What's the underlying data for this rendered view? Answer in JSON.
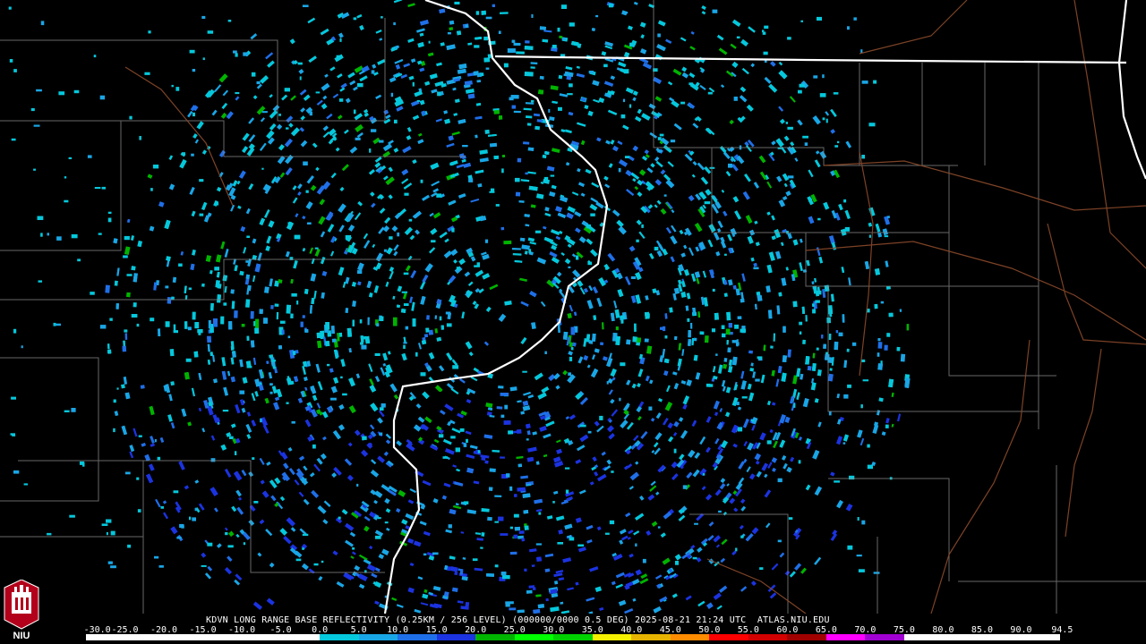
{
  "product": {
    "title": "KDVN LONG RANGE BASE REFLECTIVITY (0.25KM / 256 LEVEL) (000000/0000 0.5 DEG) 2025-08-21 21:24 UTC  ATLAS.NIU.EDU"
  },
  "scale": {
    "labels": [
      "-30.0",
      "-25.0",
      "-20.0",
      "-15.0",
      "-10.0",
      "-5.0",
      "0.0",
      "5.0",
      "10.0",
      "15.0",
      "20.0",
      "25.0",
      "30.0",
      "35.0",
      "40.0",
      "45.0",
      "50.0",
      "55.0",
      "60.0",
      "65.0",
      "70.0",
      "75.0",
      "80.0",
      "85.0",
      "90.0",
      "94.5"
    ],
    "colors": [
      "#ffffff",
      "#ffffff",
      "#ffffff",
      "#ffffff",
      "#ffffff",
      "#ffffff",
      "#05c8dc",
      "#19a6e6",
      "#1f6fe8",
      "#1b33e0",
      "#00b400",
      "#00ff00",
      "#00d200",
      "#f5f000",
      "#e6b400",
      "#ff8c00",
      "#ff0000",
      "#d20000",
      "#a00000",
      "#ff00ff",
      "#a000d2",
      "#ffffff",
      "#ffffff",
      "#ffffff",
      "#ffffff"
    ]
  },
  "logo": {
    "text": "NIU"
  },
  "map_style": {
    "background": "#000000",
    "state_border_color": "#ffffff",
    "county_line_color": "#8a8a8a",
    "road_color": "#8b4a2b",
    "radar_site_marker": "#000000",
    "echo_colors": [
      "#05c8dc",
      "#19a6e6",
      "#1f6fe8",
      "#1b33e0",
      "#00b400"
    ]
  }
}
